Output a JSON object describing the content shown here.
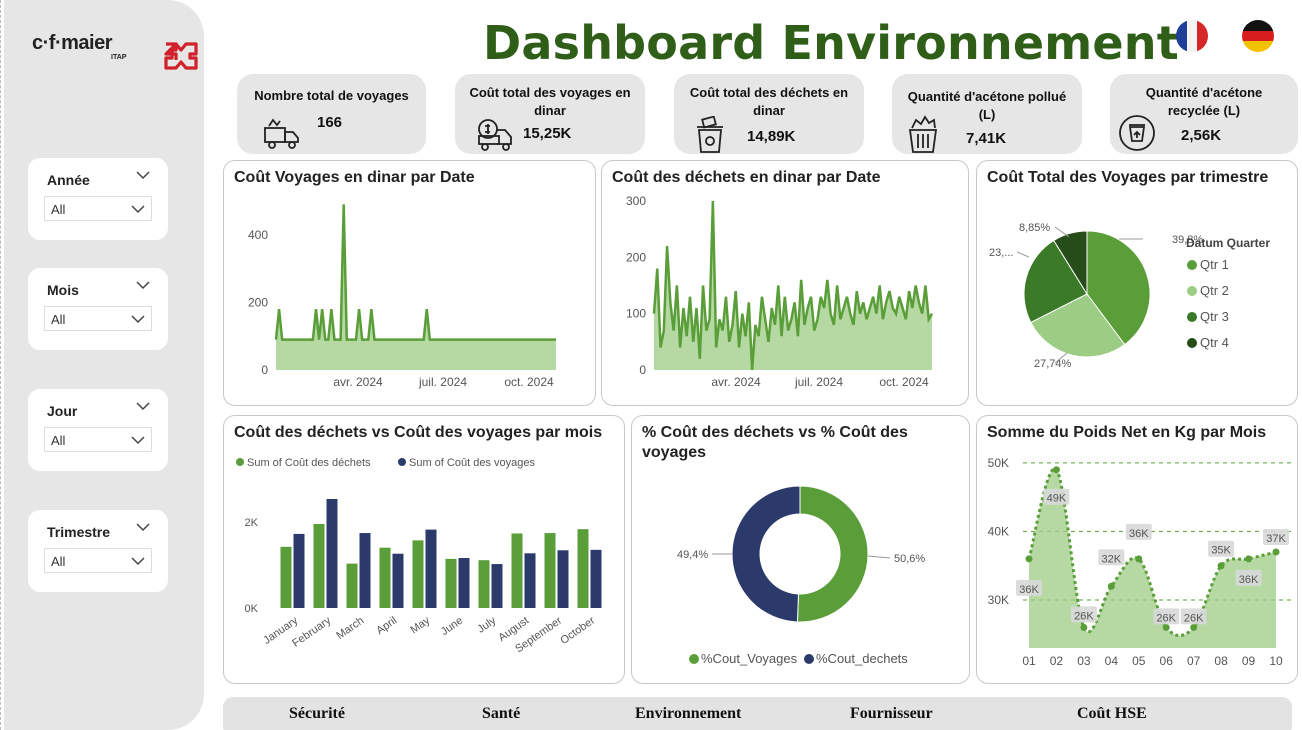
{
  "brand": {
    "name": "c·f·maier",
    "sub": "ITAP"
  },
  "title": "Dashboard Environnement",
  "slicers": [
    {
      "label": "Année",
      "value": "All"
    },
    {
      "label": "Mois",
      "value": "All"
    },
    {
      "label": "Jour",
      "value": "All"
    },
    {
      "label": "Trimestre",
      "value": "All"
    }
  ],
  "kpis": [
    {
      "label": "Nombre total de voyages",
      "value": "166",
      "icon": "garbage-truck-icon"
    },
    {
      "label": "Coût total des voyages en dinar",
      "value": "15,25K",
      "icon": "money-truck-icon"
    },
    {
      "label": "Coût total des déchets en dinar",
      "value": "14,89K",
      "icon": "waste-bin-money-icon"
    },
    {
      "label": "Quantité d'acétone pollué (L)",
      "value": "7,41K",
      "icon": "overflowing-bin-icon"
    },
    {
      "label": "Quantité d'acétone recyclée (L)",
      "value": "2,56K",
      "icon": "recycle-bin-icon"
    }
  ],
  "nav": [
    "Sécurité",
    "Santé",
    "Environnement",
    "Fournisseur",
    "Coût HSE"
  ],
  "colors": {
    "green": "#5a9e3a",
    "light_green": "#9dcc85",
    "dark_green": "#3a7a28",
    "darkest_green": "#264d19",
    "navy": "#2b3a6b",
    "title": "#2e5e17"
  },
  "chart_data": [
    {
      "id": "voyages",
      "type": "area",
      "title": "Coût Voyages en dinar par Date",
      "x_ticks": [
        "avr. 2024",
        "juil. 2024",
        "oct. 2024"
      ],
      "y_ticks": [
        "0",
        "200",
        "400"
      ],
      "ylim": [
        0,
        500
      ],
      "y_points": [
        90,
        180,
        90,
        90,
        90,
        90,
        90,
        90,
        90,
        90,
        90,
        90,
        90,
        180,
        90,
        180,
        90,
        90,
        180,
        90,
        90,
        90,
        490,
        90,
        90,
        90,
        90,
        180,
        90,
        90,
        90,
        180,
        90,
        90,
        90,
        90,
        90,
        90,
        90,
        90,
        90,
        90,
        90,
        90,
        90,
        90,
        90,
        90,
        90,
        180,
        90,
        90,
        90,
        90,
        90,
        90,
        90,
        90,
        90,
        90,
        90,
        90,
        90,
        90,
        90,
        90,
        90,
        90,
        90,
        90,
        90,
        90,
        90,
        90,
        90,
        90,
        90,
        90,
        90,
        90,
        90,
        90,
        90,
        90,
        90,
        90,
        90,
        90,
        90,
        90,
        90,
        90
      ]
    },
    {
      "id": "dechets",
      "type": "area",
      "title": "Coût des déchets en dinar par Date",
      "x_ticks": [
        "avr. 2024",
        "juil. 2024",
        "oct. 2024"
      ],
      "y_ticks": [
        "0",
        "100",
        "200",
        "300"
      ],
      "ylim": [
        0,
        300
      ],
      "y_points": [
        100,
        180,
        40,
        70,
        220,
        120,
        70,
        150,
        40,
        110,
        60,
        130,
        50,
        110,
        20,
        150,
        70,
        90,
        300,
        40,
        90,
        70,
        130,
        50,
        80,
        140,
        40,
        100,
        60,
        120,
        0,
        80,
        60,
        130,
        90,
        50,
        110,
        80,
        150,
        60,
        130,
        70,
        90,
        120,
        60,
        160,
        80,
        110,
        130,
        70,
        90,
        130,
        110,
        160,
        100,
        80,
        150,
        90,
        110,
        130,
        100,
        80,
        140,
        100,
        120,
        90,
        110,
        130,
        100,
        150,
        90,
        120,
        140,
        110,
        100,
        130,
        110,
        90,
        140,
        110,
        150,
        120,
        100,
        150,
        90,
        100
      ]
    },
    {
      "id": "trimestre",
      "type": "pie",
      "title": "Coût Total des Voyages par trimestre",
      "legend_title": "Datum Quarter",
      "slices": [
        {
          "label": "Qtr 1",
          "value": 39.8,
          "data_label": "39,8%",
          "color": "#5a9e3a"
        },
        {
          "label": "Qtr 2",
          "value": 27.74,
          "data_label": "27,74%",
          "color": "#9dcc85"
        },
        {
          "label": "Qtr 3",
          "value": 23.61,
          "data_label": "23,...",
          "color": "#3a7a28"
        },
        {
          "label": "Qtr 4",
          "value": 8.85,
          "data_label": "8,85%",
          "color": "#264d19"
        }
      ]
    },
    {
      "id": "mois",
      "type": "bar",
      "title": "Coût des déchets vs Coût des voyages par mois",
      "categories": [
        "January",
        "February",
        "March",
        "April",
        "May",
        "June",
        "July",
        "August",
        "September",
        "October"
      ],
      "y_ticks": [
        "0K",
        "2K"
      ],
      "ylim": [
        0,
        2600
      ],
      "series": [
        {
          "name": "Sum of Coût des déchets",
          "color": "#5a9e3a",
          "values": [
            1420,
            1950,
            1030,
            1400,
            1570,
            1140,
            1110,
            1730,
            1740,
            1830
          ]
        },
        {
          "name": "Sum of Coût des voyages",
          "color": "#2b3a6b",
          "values": [
            1720,
            2530,
            1740,
            1260,
            1820,
            1160,
            1020,
            1270,
            1340,
            1350
          ]
        }
      ]
    },
    {
      "id": "pct",
      "type": "pie",
      "title": "% Coût des déchets vs % Coût des voyages",
      "donut": true,
      "slices": [
        {
          "label": "%Cout_Voyages",
          "value": 50.6,
          "data_label": "50,6%",
          "color": "#5a9e3a"
        },
        {
          "label": "%Cout_dechets",
          "value": 49.4,
          "data_label": "49,4%",
          "color": "#2b3a6b"
        }
      ]
    },
    {
      "id": "poids",
      "type": "area",
      "title": "Somme du Poids Net en Kg par Mois",
      "categories": [
        "01",
        "02",
        "03",
        "04",
        "05",
        "06",
        "07",
        "08",
        "09",
        "10"
      ],
      "values": [
        36000,
        49000,
        26000,
        32000,
        36000,
        26000,
        26000,
        35000,
        36000,
        37000
      ],
      "data_labels": [
        "36K",
        "49K",
        "26K",
        "32K",
        "36K",
        "26K",
        "26K",
        "35K",
        "36K",
        "37K"
      ],
      "y_ticks": [
        "30K",
        "40K",
        "50K"
      ],
      "ylim": [
        23000,
        51000
      ]
    }
  ]
}
